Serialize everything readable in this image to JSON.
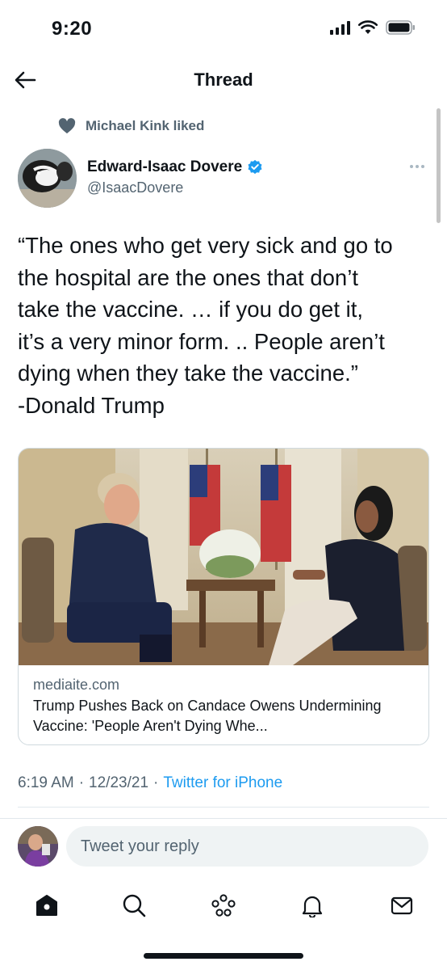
{
  "status_bar": {
    "time": "9:20"
  },
  "header": {
    "title": "Thread"
  },
  "social_context": {
    "text": "Michael Kink liked"
  },
  "author": {
    "name": "Edward-Isaac Dovere",
    "handle": "@IsaacDovere",
    "verified": true
  },
  "tweet": {
    "text": "“The ones who get very sick and go to\nthe hospital are the ones that don’t\ntake the vaccine. … if you do get it,\nit’s a very minor form. .. People aren’t\ndying when they take the vaccine.”\n-Donald Trump"
  },
  "card": {
    "domain": "mediaite.com",
    "title": "Trump Pushes Back on Candace Owens Undermining Vaccine: 'People Aren't Dying Whe..."
  },
  "meta": {
    "time": "6:19 AM",
    "separator": "·",
    "date": "12/23/21",
    "source": "Twitter for iPhone"
  },
  "reply": {
    "placeholder": "Tweet your reply"
  },
  "nav": {
    "items": [
      "home-icon",
      "search-icon",
      "spaces-icon",
      "notifications-icon",
      "messages-icon"
    ]
  },
  "colors": {
    "accent": "#1d9bf0",
    "text": "#0f1419",
    "secondary": "#536471"
  }
}
